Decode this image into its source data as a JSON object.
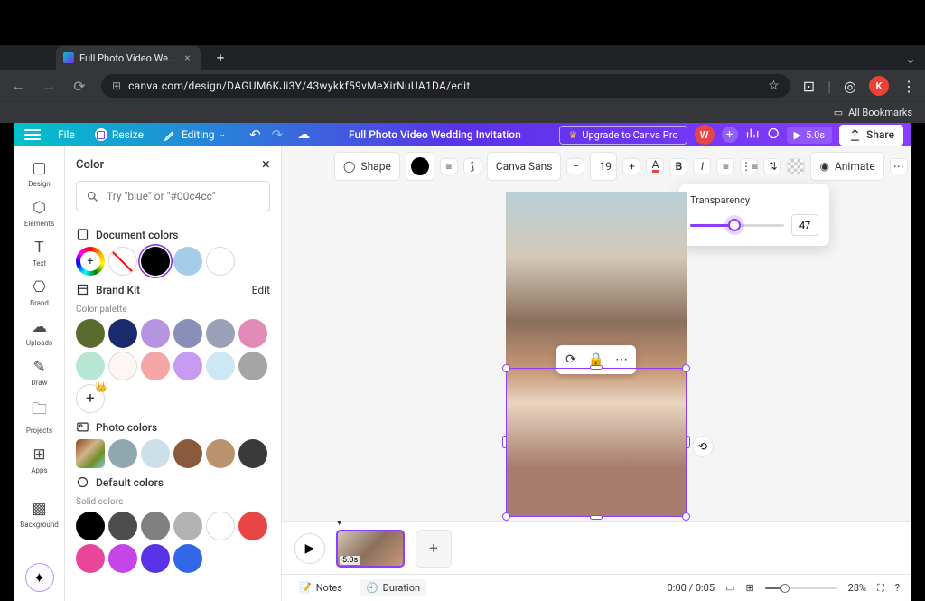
{
  "browser": {
    "tab_title": "Full Photo Video Wedding Invitation",
    "url": "canva.com/design/DAGUM6KJi3Y/43wykkf59vMeXirNuUA1DA/edit",
    "bookmarks_label": "All Bookmarks",
    "profile_letter": "K"
  },
  "topbar": {
    "file": "File",
    "resize": "Resize",
    "editing": "Editing",
    "doc_title": "Full Photo Video Wedding Invitation",
    "upgrade": "Upgrade to Canva Pro",
    "avatar_letter": "W",
    "play_duration": "5.0s",
    "share": "Share"
  },
  "nav": {
    "design": "Design",
    "elements": "Elements",
    "text": "Text",
    "brand": "Brand",
    "uploads": "Uploads",
    "draw": "Draw",
    "projects": "Projects",
    "apps": "Apps",
    "background": "Background"
  },
  "color_panel": {
    "title": "Color",
    "search_placeholder": "Try \"blue\" or \"#00c4cc\"",
    "document_colors": "Document colors",
    "brand_kit": "Brand Kit",
    "edit": "Edit",
    "color_palette": "Color palette",
    "photo_colors": "Photo colors",
    "default_colors": "Default colors",
    "solid_colors": "Solid colors",
    "palettes": {
      "document": [
        "#a5cce8",
        "#ffffff"
      ],
      "brand": [
        "#5a6b2f",
        "#1a2a6c",
        "#b794e0",
        "#8a8fb8",
        "#9aa0b5",
        "#e28bb8",
        "#b8e6d4",
        "#fff5f5",
        "#f4a5a5",
        "#c79bf0",
        "#cce8f4",
        "#a5a5a5"
      ],
      "photo": [
        "#8fa8b0",
        "#cce0e8",
        "#8b5a3c",
        "#b8936e",
        "#3a3a3a"
      ],
      "default": [
        "#000000",
        "#4d4d4d",
        "#808080",
        "#b3b3b3",
        "#ffffff",
        "#e84545",
        "#e8459b",
        "#c545e8",
        "#5a32e8",
        "#3268e8"
      ]
    }
  },
  "context_toolbar": {
    "shape": "Shape",
    "font": "Canva Sans",
    "font_size": "19",
    "animate": "Animate"
  },
  "transparency": {
    "label": "Transparency",
    "value": "47",
    "percent": 47
  },
  "timeline": {
    "thumb_duration": "5.0s"
  },
  "bottombar": {
    "notes": "Notes",
    "duration": "Duration",
    "time": "0:00 / 0:05",
    "zoom": "28%"
  }
}
